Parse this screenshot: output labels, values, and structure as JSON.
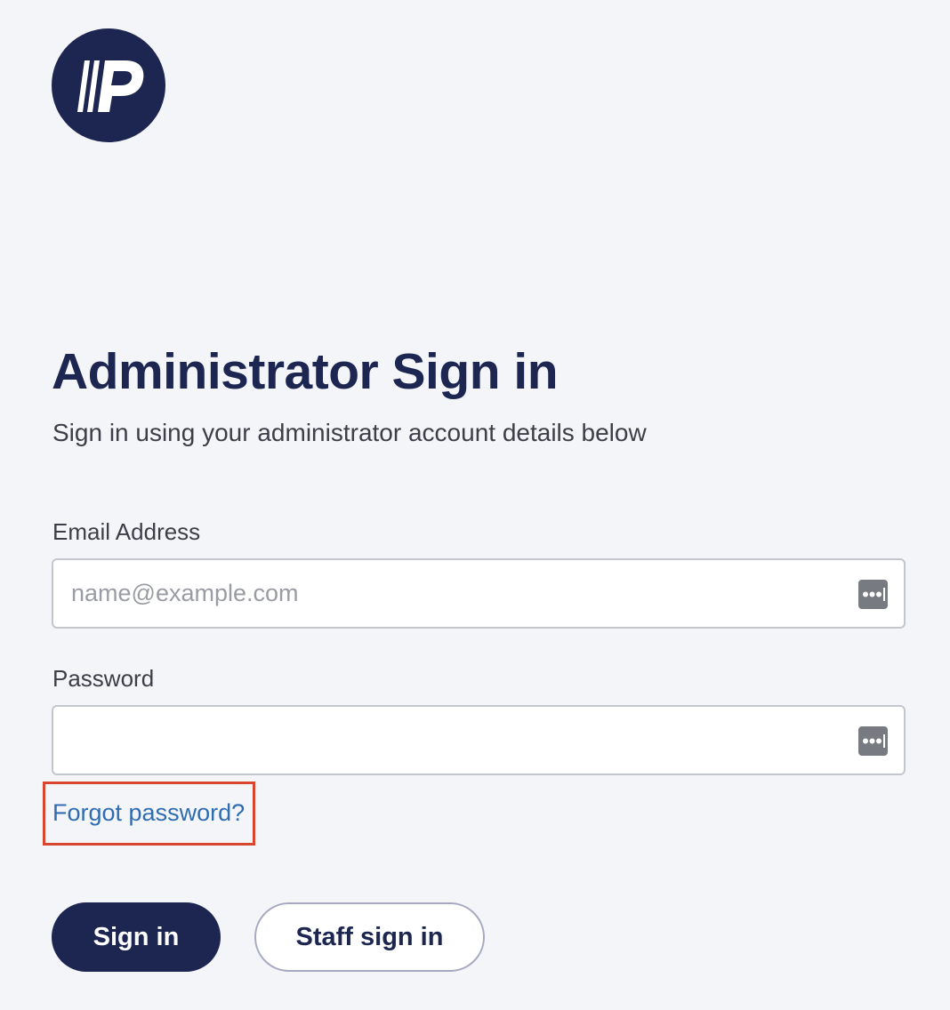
{
  "brand": {
    "logo_letter": "P",
    "logo_color": "#1c2651"
  },
  "header": {
    "title": "Administrator Sign in",
    "subtitle": "Sign in using your administrator account details below"
  },
  "form": {
    "email": {
      "label": "Email Address",
      "placeholder": "name@example.com",
      "value": "",
      "icon": "password-manager-icon"
    },
    "password": {
      "label": "Password",
      "placeholder": "",
      "value": "",
      "icon": "password-manager-icon"
    },
    "forgot_link": "Forgot password?",
    "highlight_color": "#d9462f"
  },
  "actions": {
    "sign_in": "Sign in",
    "staff_sign_in": "Staff sign in"
  },
  "colors": {
    "primary": "#1c2651",
    "link": "#2f6db0",
    "background": "#f4f5f9"
  }
}
